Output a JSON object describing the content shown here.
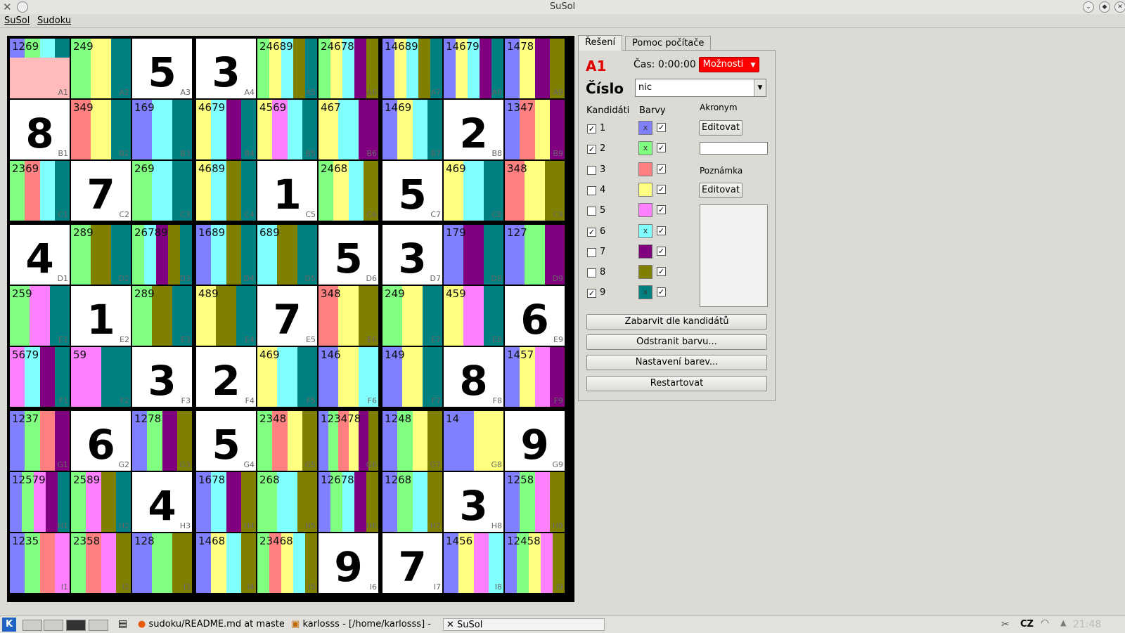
{
  "window": {
    "title": "SuSol",
    "app_icon": "kde-x-icon",
    "controls": [
      "minimize-icon",
      "maximize-icon",
      "close-icon"
    ]
  },
  "menu": [
    "SuSol",
    "Sudoku"
  ],
  "palette": {
    "1": "#8080ff",
    "2": "#80ff80",
    "3": "#ff8080",
    "4": "#ffff80",
    "5": "#ff80ff",
    "6": "#80ffff",
    "7": "#800080",
    "8": "#808000",
    "9": "#008080",
    "selected": "#ffbbbb"
  },
  "grid": {
    "rows": [
      "A",
      "B",
      "C",
      "D",
      "E",
      "F",
      "G",
      "H",
      "I"
    ],
    "cells": [
      [
        {
          "c": "1269",
          "sel": true
        },
        {
          "c": "249"
        },
        {
          "v": "5"
        },
        {
          "v": "3"
        },
        {
          "c": "24689"
        },
        {
          "c": "24678"
        },
        {
          "c": "14689"
        },
        {
          "c": "14679"
        },
        {
          "c": "1478"
        }
      ],
      [
        {
          "v": "8"
        },
        {
          "c": "349"
        },
        {
          "c": "169"
        },
        {
          "c": "4679"
        },
        {
          "c": "4569"
        },
        {
          "c": "467"
        },
        {
          "c": "1469"
        },
        {
          "v": "2"
        },
        {
          "c": "1347"
        }
      ],
      [
        {
          "c": "2369"
        },
        {
          "v": "7"
        },
        {
          "c": "269"
        },
        {
          "c": "4689"
        },
        {
          "v": "1"
        },
        {
          "c": "2468"
        },
        {
          "v": "5"
        },
        {
          "c": "469"
        },
        {
          "c": "348"
        }
      ],
      [
        {
          "v": "4"
        },
        {
          "c": "289"
        },
        {
          "c": "26789"
        },
        {
          "c": "1689"
        },
        {
          "c": "689"
        },
        {
          "v": "5"
        },
        {
          "v": "3"
        },
        {
          "c": "179"
        },
        {
          "c": "127"
        }
      ],
      [
        {
          "c": "259"
        },
        {
          "v": "1"
        },
        {
          "c": "289"
        },
        {
          "c": "489"
        },
        {
          "v": "7"
        },
        {
          "c": "348"
        },
        {
          "c": "249"
        },
        {
          "c": "459"
        },
        {
          "v": "6"
        }
      ],
      [
        {
          "c": "5679"
        },
        {
          "c": "59"
        },
        {
          "v": "3"
        },
        {
          "v": "2"
        },
        {
          "c": "469"
        },
        {
          "c": "146"
        },
        {
          "c": "149"
        },
        {
          "v": "8"
        },
        {
          "c": "1457"
        }
      ],
      [
        {
          "c": "1237"
        },
        {
          "v": "6"
        },
        {
          "c": "1278"
        },
        {
          "v": "5"
        },
        {
          "c": "2348"
        },
        {
          "c": "123478"
        },
        {
          "c": "1248"
        },
        {
          "c": "14"
        },
        {
          "v": "9"
        }
      ],
      [
        {
          "c": "12579"
        },
        {
          "c": "2589"
        },
        {
          "v": "4"
        },
        {
          "c": "1678"
        },
        {
          "c": "268"
        },
        {
          "c": "12678"
        },
        {
          "c": "1268"
        },
        {
          "v": "3"
        },
        {
          "c": "1258"
        }
      ],
      [
        {
          "c": "1235"
        },
        {
          "c": "2358"
        },
        {
          "c": "128"
        },
        {
          "c": "1468"
        },
        {
          "c": "23468"
        },
        {
          "v": "9"
        },
        {
          "v": "7"
        },
        {
          "c": "1456"
        },
        {
          "c": "12458"
        }
      ]
    ]
  },
  "panel": {
    "tabs": [
      "Řešení",
      "Pomoc počítače"
    ],
    "cell_name": "A1",
    "time_label": "Čas: 0:00:00",
    "options_button": "Možnosti",
    "number_label": "Číslo",
    "number_value": "nic",
    "candidates_header": "Kandidáti",
    "colors_header": "Barvy",
    "acronym_header": "Akronym",
    "edit_label": "Editovat",
    "note_header": "Poznámka",
    "acronym_value": "",
    "note_value": "",
    "candidates": [
      {
        "n": "1",
        "checked": true,
        "color": "#8080ff",
        "x": true
      },
      {
        "n": "2",
        "checked": true,
        "color": "#80ff80",
        "x": true
      },
      {
        "n": "3",
        "checked": false,
        "color": "#ff8080",
        "x": false
      },
      {
        "n": "4",
        "checked": false,
        "color": "#ffff80",
        "x": false
      },
      {
        "n": "5",
        "checked": false,
        "color": "#ff80ff",
        "x": false
      },
      {
        "n": "6",
        "checked": true,
        "color": "#80ffff",
        "x": true
      },
      {
        "n": "7",
        "checked": false,
        "color": "#800080",
        "x": false
      },
      {
        "n": "8",
        "checked": false,
        "color": "#808000",
        "x": false
      },
      {
        "n": "9",
        "checked": true,
        "color": "#008080",
        "x": true
      }
    ],
    "buttons": [
      "Zabarvit dle kandidátů",
      "Odstranit barvu...",
      "Nastavení barev...",
      "Restartovat"
    ]
  },
  "taskbar": {
    "tasks": [
      "sudoku/README.md at maste",
      "karlosss - [/home/karlosss] -",
      "SuSol"
    ],
    "layout": "CZ",
    "clock": "21:48"
  }
}
